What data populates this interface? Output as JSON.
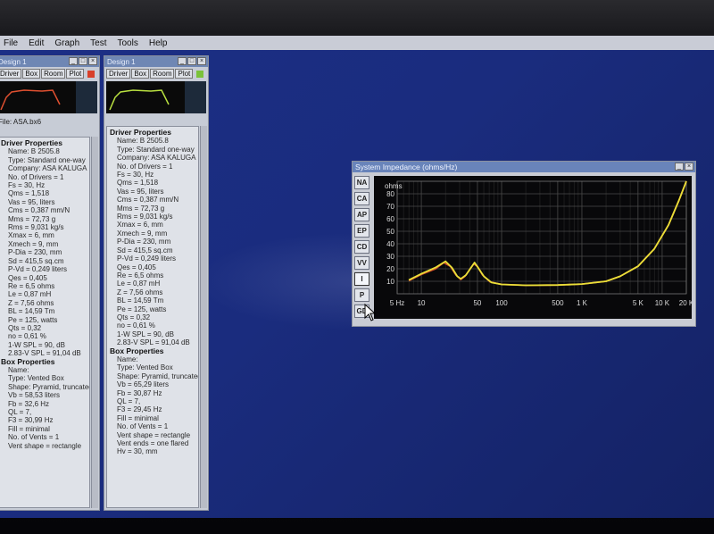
{
  "menu": [
    "File",
    "Edit",
    "Graph",
    "Test",
    "Tools",
    "Help"
  ],
  "design1": {
    "title": "Design 1",
    "tabs": [
      "Driver",
      "Box",
      "Room",
      "Plot"
    ],
    "led_color": "#d8402a",
    "curve_color": "#e05030",
    "file": "File: ASA.bx6",
    "driver_header": "Driver Properties",
    "driver_lines": [
      "Name: B 2505.8",
      "Type: Standard one-way",
      "Company: ASA KALUGA",
      "No. of Drivers = 1",
      "Fs = 30, Hz",
      "Qms = 1,518",
      "Vas = 95, liters",
      "Cms = 0,387 mm/N",
      "Mms = 72,73 g",
      "Rms = 9,031 kg/s",
      "Xmax = 6, mm",
      "Xmech = 9, mm",
      "P-Dia = 230, mm",
      "Sd = 415,5 sq.cm",
      "P-Vd = 0,249 liters",
      "Qes = 0,405",
      "Re = 6,5 ohms",
      "Le = 0,87 mH",
      "Z = 7,56 ohms",
      "BL = 14,59 Tm",
      "Pe = 125, watts",
      "Qts = 0,32",
      "no = 0,61 %",
      "1-W SPL = 90, dB",
      "2.83-V SPL = 91,04 dB"
    ],
    "box_header": "Box Properties",
    "box_lines": [
      "Name:",
      "Type: Vented Box",
      "Shape: Pyramid, truncated",
      "Vb = 58,53 liters",
      "Fb = 32,6 Hz",
      "QL = 7,",
      "F3 = 30,99 Hz",
      "Fill = minimal",
      "No. of Vents = 1",
      "Vent shape = rectangle"
    ]
  },
  "design2": {
    "title": "Design 1",
    "tabs": [
      "Driver",
      "Box",
      "Room",
      "Plot"
    ],
    "led_color": "#7ac23a",
    "curve_color": "#b9e040",
    "driver_header": "Driver Properties",
    "driver_lines": [
      "Name: B 2505.8",
      "Type: Standard one-way",
      "Company: ASA KALUGA",
      "No. of Drivers = 1",
      "Fs = 30, Hz",
      "Qms = 1,518",
      "Vas = 95, liters",
      "Cms = 0,387 mm/N",
      "Mms = 72,73 g",
      "Rms = 9,031 kg/s",
      "Xmax = 6, mm",
      "Xmech = 9, mm",
      "P-Dia = 230, mm",
      "Sd = 415,5 sq.cm",
      "P-Vd = 0,249 liters",
      "Qes = 0,405",
      "Re = 6,5 ohms",
      "Le = 0,87 mH",
      "Z = 7,56 ohms",
      "BL = 14,59 Tm",
      "Pe = 125, watts",
      "Qts = 0,32",
      "no = 0,61 %",
      "1-W SPL = 90, dB",
      "2.83-V SPL = 91,04 dB"
    ],
    "box_header": "Box Properties",
    "box_lines": [
      "Name:",
      "Type: Vented Box",
      "Shape: Pyramid, truncated",
      "Vb = 65,29 liters",
      "Fb = 30,87 Hz",
      "QL = 7,",
      "F3 = 29,45 Hz",
      "Fill = minimal",
      "No. of Vents = 1",
      "Vent shape = rectangle",
      "Vent ends = one flared",
      "Hv = 30, mm"
    ]
  },
  "impedance": {
    "title": "System Impedance (ohms/Hz)",
    "side_buttons": [
      "NA",
      "CA",
      "AP",
      "EP",
      "CD",
      "VV",
      "I",
      "P",
      "GD"
    ],
    "active_button": "I",
    "icons": [
      "minimize-icon",
      "close-icon",
      "pointer-cursor-icon"
    ]
  },
  "chart_data": {
    "type": "line",
    "title": "System Impedance (ohms/Hz)",
    "ylabel": "ohms",
    "xlim": [
      5,
      20000
    ],
    "ylim": [
      0,
      90
    ],
    "x_scale": "log",
    "grid": true,
    "x_tick_labels": [
      "5 Hz",
      "10",
      "50",
      "100",
      "500",
      "1 K",
      "5 K",
      "10 K",
      "20 K"
    ],
    "x_ticks": [
      5,
      10,
      50,
      100,
      500,
      1000,
      5000,
      10000,
      20000
    ],
    "y_ticks": [
      10,
      20,
      30,
      40,
      50,
      60,
      70,
      80
    ],
    "series": [
      {
        "color": "#e8e038",
        "x": [
          7,
          10,
          15,
          20,
          24,
          28,
          31,
          36,
          46,
          52,
          60,
          75,
          100,
          200,
          500,
          1000,
          2000,
          3000,
          5000,
          8000,
          12000,
          16000,
          20000
        ],
        "y": [
          11,
          16,
          21,
          26,
          21,
          14,
          12,
          15,
          25,
          20,
          14,
          9,
          7.5,
          6.8,
          7,
          7.8,
          10,
          14,
          22,
          36,
          55,
          74,
          90
        ]
      },
      {
        "color": "#d8502a",
        "x": [
          7,
          10,
          15,
          19,
          23,
          27,
          31,
          35,
          45,
          50,
          58,
          72,
          100,
          200,
          500,
          1000,
          2000,
          3000,
          5000,
          8000,
          12000,
          16000,
          20000
        ],
        "y": [
          10.5,
          15.5,
          20,
          25,
          22,
          15,
          11.5,
          14,
          24,
          22,
          15,
          9.5,
          7.5,
          6.8,
          7,
          7.8,
          10,
          14,
          22,
          36,
          55,
          74,
          90
        ]
      }
    ]
  }
}
